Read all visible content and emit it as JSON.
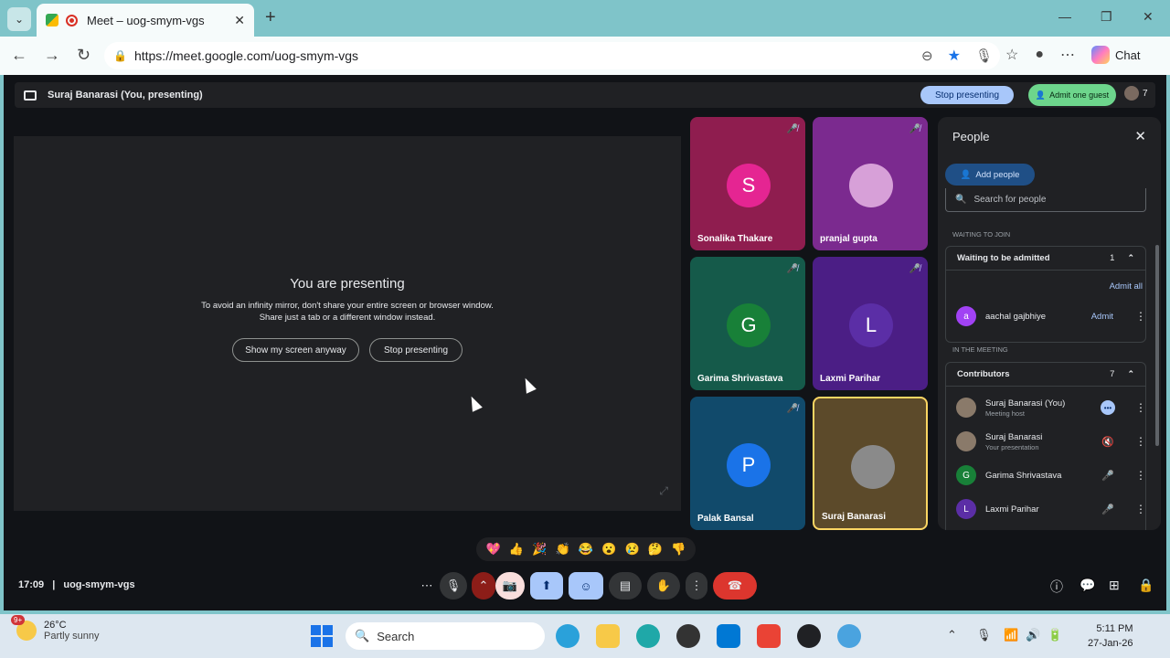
{
  "browser": {
    "tab_title": "Meet – uog-smym-vgs",
    "url": "https://meet.google.com/uog-smym-vgs",
    "chat_label": "Chat"
  },
  "meet": {
    "presenting_label": "Suraj Banarasi (You, presenting)",
    "stop_presenting_top": "Stop presenting",
    "admit_guest": "Admit one guest",
    "participant_count": "7",
    "stage": {
      "title": "You are presenting",
      "message_line1": "To avoid an infinity mirror, don't share your entire screen or browser window.",
      "message_line2": "Share just a tab or a different window instead.",
      "show_screen_btn": "Show my screen anyway",
      "stop_presenting_btn": "Stop presenting"
    },
    "tiles": [
      {
        "name": "Sonalika Thakare",
        "initial": "S",
        "bg": "#8f1d4f",
        "avatar": "#e52592"
      },
      {
        "name": "pranjal gupta",
        "initial": "",
        "bg": "#7b2a8f",
        "avatar": "#d7a0d8"
      },
      {
        "name": "Garima Shrivastava",
        "initial": "G",
        "bg": "#155a4a",
        "avatar": "#188038"
      },
      {
        "name": "Laxmi Parihar",
        "initial": "L",
        "bg": "#4b1e85",
        "avatar": "#5b2ea6"
      },
      {
        "name": "Palak Bansal",
        "initial": "P",
        "bg": "#114a6b",
        "avatar": "#1a73e8"
      },
      {
        "name": "Suraj Banarasi",
        "initial": "",
        "bg": "#5c4a2a",
        "avatar": "#8a8a8a"
      }
    ],
    "meeting_time": "17:09",
    "meeting_code": "uog-smym-vgs"
  },
  "people_panel": {
    "title": "People",
    "add_people": "Add people",
    "search_placeholder": "Search for people",
    "waiting_label": "WAITING TO JOIN",
    "waiting_group": "Waiting to be admitted",
    "waiting_count": "1",
    "admit_all": "Admit all",
    "waiting_person": {
      "name": "aachal gajbhiye",
      "initial": "a",
      "admit": "Admit"
    },
    "in_meeting_label": "IN THE MEETING",
    "contributors_group": "Contributors",
    "contributors_count": "7",
    "contributors": [
      {
        "name": "Suraj Banarasi (You)",
        "sub": "Meeting host",
        "initial": "",
        "color": "#8a7a6a"
      },
      {
        "name": "Suraj Banarasi",
        "sub": "Your presentation",
        "initial": "",
        "color": "#8a7a6a"
      },
      {
        "name": "Garima Shrivastava",
        "sub": "",
        "initial": "G",
        "color": "#188038"
      },
      {
        "name": "Laxmi Parihar",
        "sub": "",
        "initial": "L",
        "color": "#5b2ea6"
      }
    ]
  },
  "reactions": [
    "💖",
    "👍",
    "🎉",
    "👏",
    "😂",
    "😮",
    "😢",
    "🤔",
    "👎"
  ],
  "taskbar": {
    "notif_badge": "9+",
    "temp": "26°C",
    "weather": "Partly sunny",
    "search_placeholder": "Search",
    "time": "5:11 PM",
    "date": "27-Jan-26"
  }
}
